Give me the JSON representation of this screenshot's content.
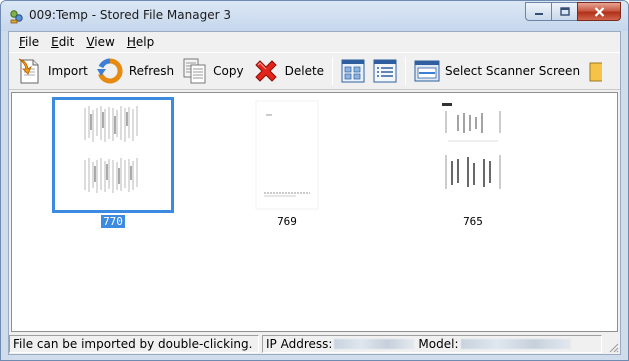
{
  "window": {
    "title": "009:Temp - Stored File Manager 3"
  },
  "menu": {
    "items": [
      {
        "underline": "F",
        "rest": "ile"
      },
      {
        "underline": "E",
        "rest": "dit"
      },
      {
        "underline": "V",
        "rest": "iew"
      },
      {
        "underline": "H",
        "rest": "elp"
      }
    ]
  },
  "toolbar": {
    "import_label": "Import",
    "refresh_label": "Refresh",
    "copy_label": "Copy",
    "delete_label": "Delete",
    "select_scanner_label": "Select Scanner Screen"
  },
  "files": [
    {
      "label": "770",
      "selected": true
    },
    {
      "label": "769",
      "selected": false
    },
    {
      "label": "765",
      "selected": false
    }
  ],
  "status": {
    "hint": "File can be imported by double-clicking.",
    "ip_label": "IP Address:",
    "model_label": "Model:"
  }
}
